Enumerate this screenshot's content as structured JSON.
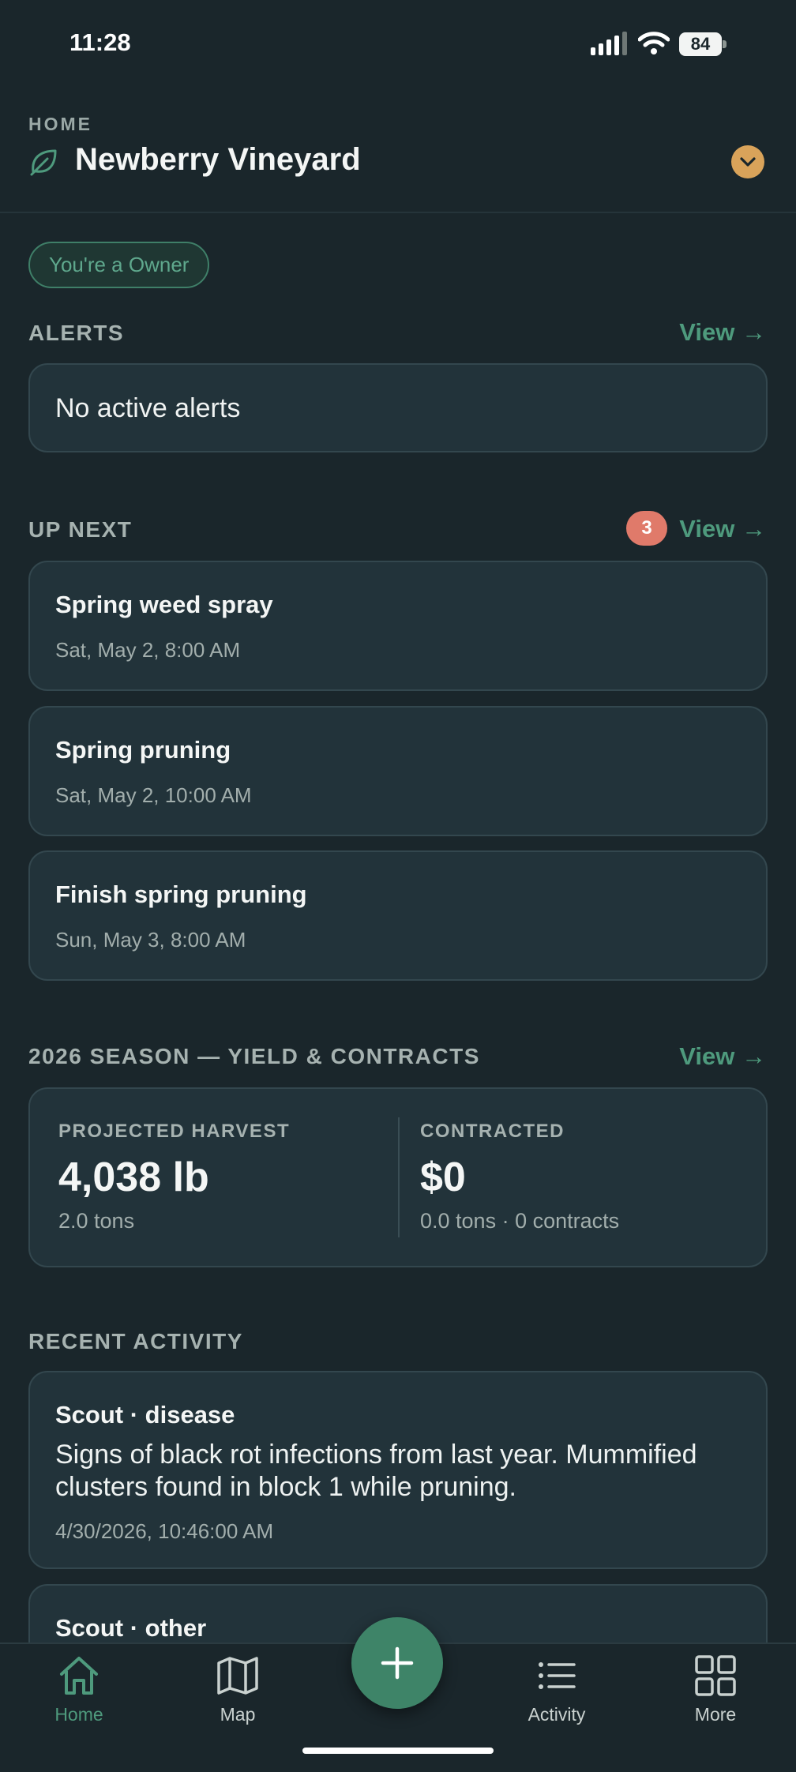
{
  "status_bar": {
    "time": "11:28",
    "battery": "84"
  },
  "header": {
    "section_label": "HOME",
    "vineyard_name": "Newberry Vineyard"
  },
  "role_badge": "You're a Owner",
  "alerts": {
    "title": "ALERTS",
    "view_label": "View →",
    "empty_text": "No active alerts"
  },
  "up_next": {
    "title": "UP NEXT",
    "count": "3",
    "view_label": "View →",
    "tasks": [
      {
        "title": "Spring weed spray",
        "date": "Sat, May 2, 8:00 AM"
      },
      {
        "title": "Spring pruning",
        "date": "Sat, May 2, 10:00 AM"
      },
      {
        "title": "Finish spring pruning",
        "date": "Sun, May 3, 8:00 AM"
      }
    ]
  },
  "season": {
    "title": "2026 SEASON — YIELD & CONTRACTS",
    "view_label": "View →",
    "projected": {
      "label": "PROJECTED HARVEST",
      "value": "4,038 lb",
      "sub": "2.0 tons"
    },
    "contracted": {
      "label": "CONTRACTED",
      "value": "$0",
      "sub": "0.0 tons · 0 contracts"
    }
  },
  "recent_activity": {
    "title": "RECENT ACTIVITY",
    "items": [
      {
        "title": "Scout · disease",
        "text": "Signs of black rot infections from last year.  Mummified clusters found in block 1 while pruning.",
        "date": "4/30/2026, 10:46:00 AM"
      },
      {
        "title": "Scout · other"
      }
    ]
  },
  "tabbar": {
    "tabs": [
      {
        "label": "Home",
        "icon": "home-icon",
        "active": true
      },
      {
        "label": "Map",
        "icon": "map-icon"
      },
      {
        "label": "Activity",
        "icon": "list-icon"
      },
      {
        "label": "More",
        "icon": "grid-icon"
      }
    ],
    "fab_icon": "plus-icon"
  },
  "colors": {
    "accent": "#4e9a7d",
    "badge": "#e07a6a",
    "chevron": "#d9a35a",
    "background": "#1a262b",
    "card": "#22333a"
  }
}
